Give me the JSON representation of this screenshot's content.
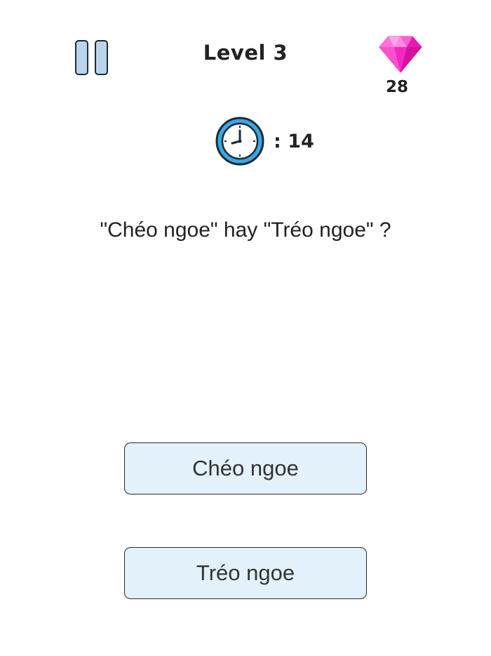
{
  "header": {
    "level_title": "Level 3",
    "gem_count": "28",
    "pause_icon": "pause-icon",
    "gem_icon": "gem-icon"
  },
  "timer": {
    "icon": "clock-icon",
    "value": ": 14"
  },
  "question": {
    "text": "\"Chéo ngoe\" hay \"Tréo ngoe\" ?"
  },
  "answers": [
    {
      "label": "Chéo ngoe"
    },
    {
      "label": "Tréo ngoe"
    }
  ],
  "colors": {
    "answer_fill": "#e3f2fa",
    "gem": "#ff33cc",
    "clock_ring": "#3aa7e6",
    "pause_fill": "#b9d5ec"
  }
}
